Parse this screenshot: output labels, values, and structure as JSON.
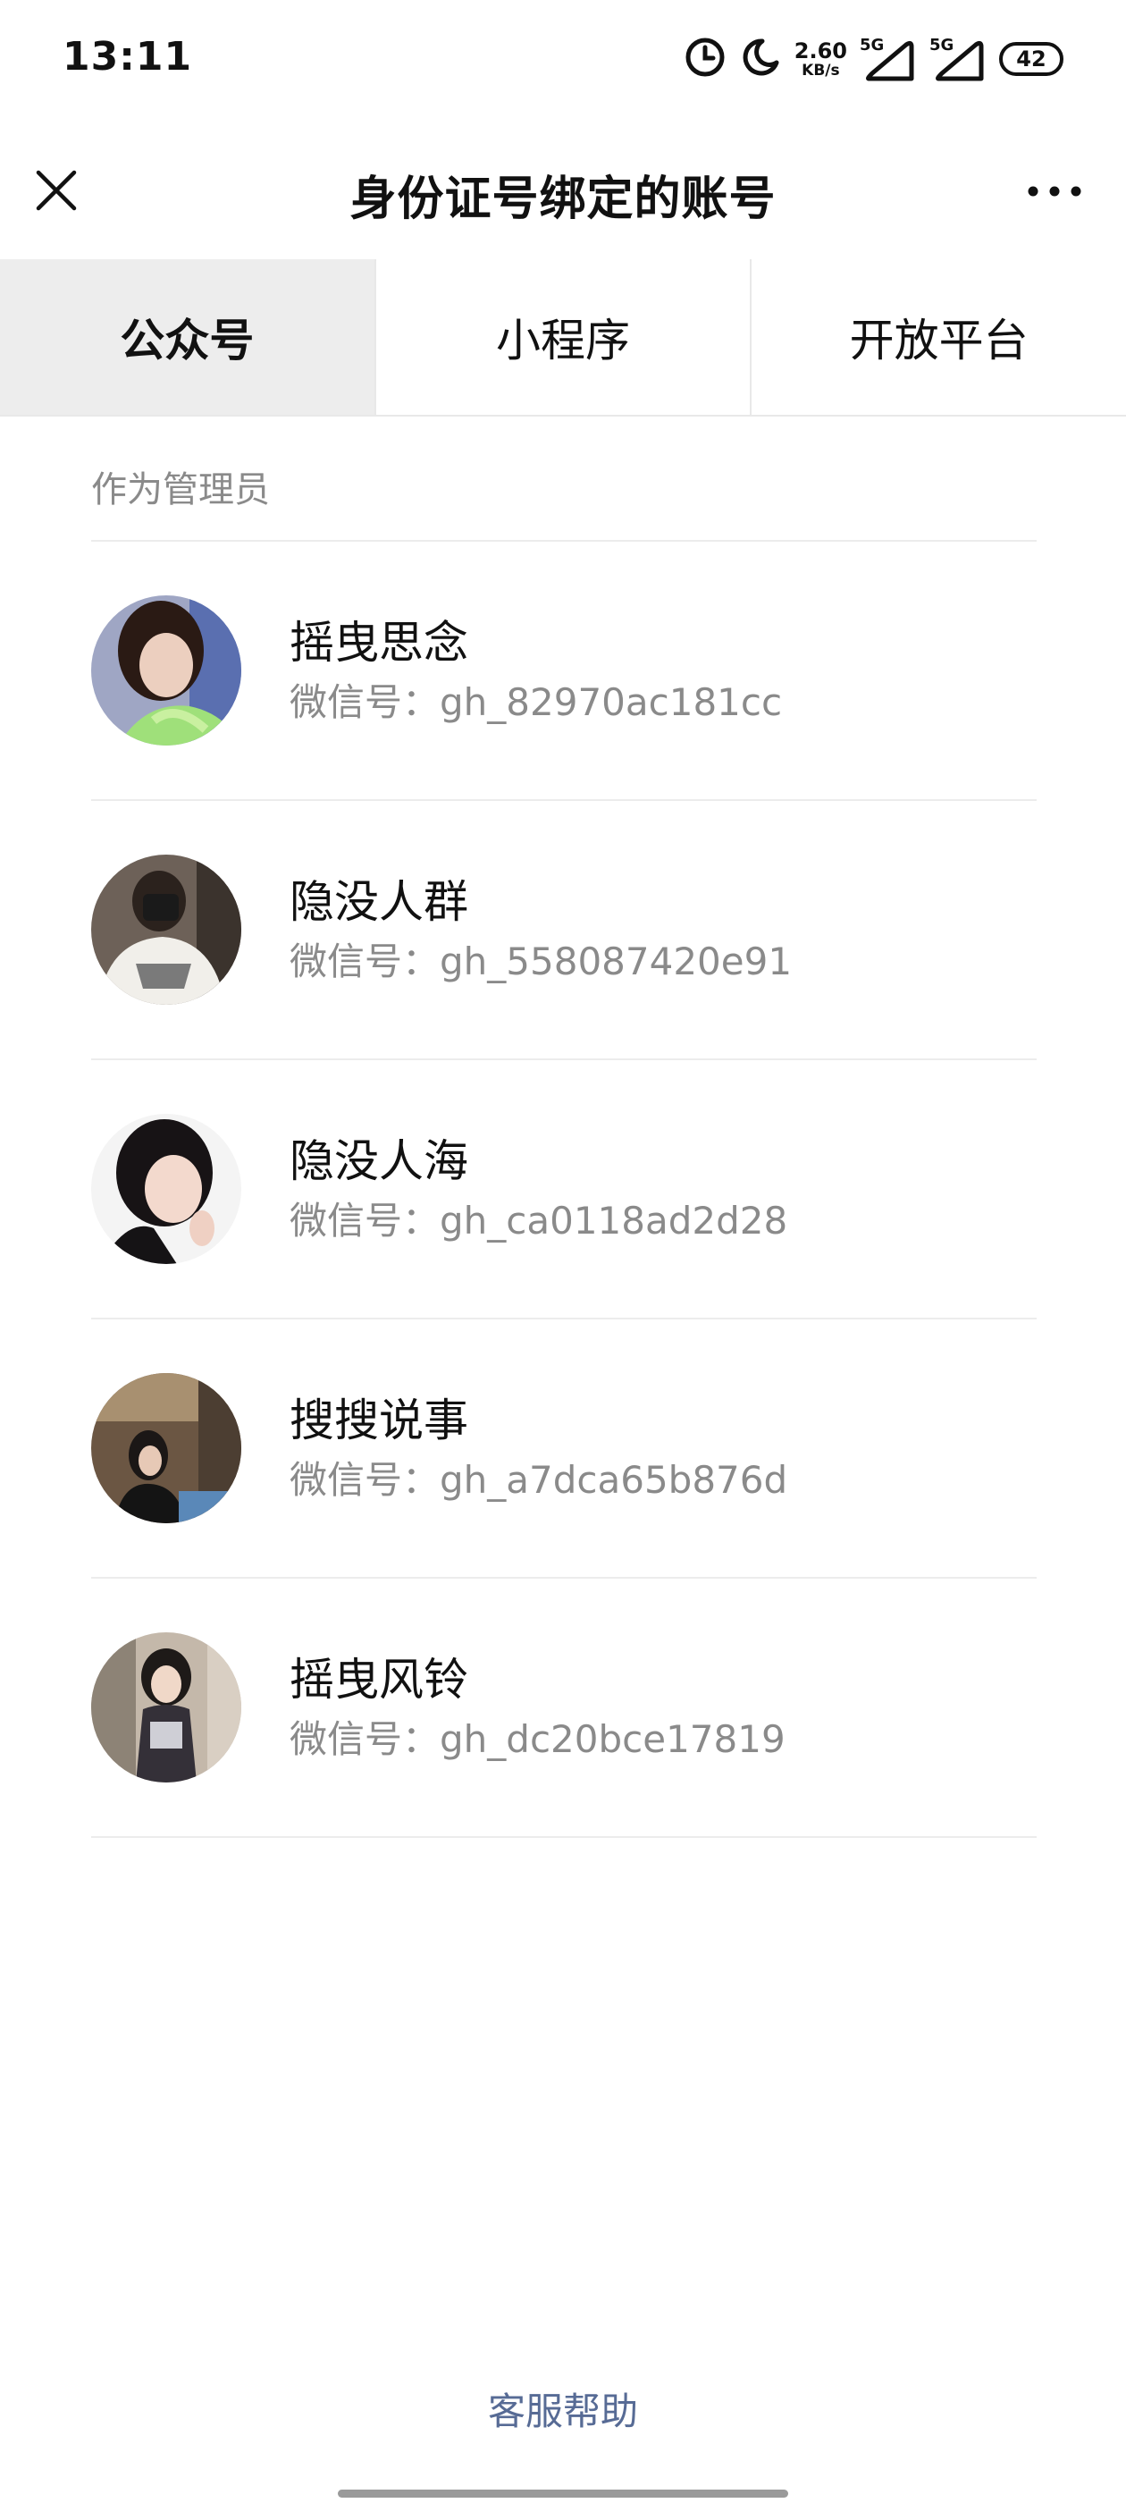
{
  "status_bar": {
    "time": "13:11",
    "net_speed_value": "2.60",
    "net_speed_unit": "KB/s",
    "sim1_label": "5G",
    "sim2_label": "5G",
    "battery": "42",
    "icons": [
      "alarm-icon",
      "moon-icon",
      "signal-icon",
      "signal-icon",
      "battery-icon"
    ]
  },
  "header": {
    "title": "身份证号绑定的账号",
    "close_icon": "close-icon",
    "more_icon": "more-icon"
  },
  "tabs": [
    {
      "label": "公众号",
      "active": true
    },
    {
      "label": "小程序",
      "active": false
    },
    {
      "label": "开放平台",
      "active": false
    }
  ],
  "section": {
    "label": "作为管理员"
  },
  "accounts": [
    {
      "name": "摇曳思念",
      "id": "微信号：gh_82970ac181cc"
    },
    {
      "name": "隐没人群",
      "id": "微信号：gh_558087420e91"
    },
    {
      "name": "隐没人海",
      "id": "微信号：gh_ca0118ad2d28"
    },
    {
      "name": "搜搜说事",
      "id": "微信号：gh_a7dca65b876d"
    },
    {
      "name": "摇曳风铃",
      "id": "微信号：gh_dc20bce17819"
    }
  ],
  "footer": {
    "help_label": "客服帮助"
  },
  "colors": {
    "link": "#576b95",
    "muted_text": "#8a8a8a",
    "active_tab_bg": "#ededed",
    "divider": "#ececec"
  }
}
